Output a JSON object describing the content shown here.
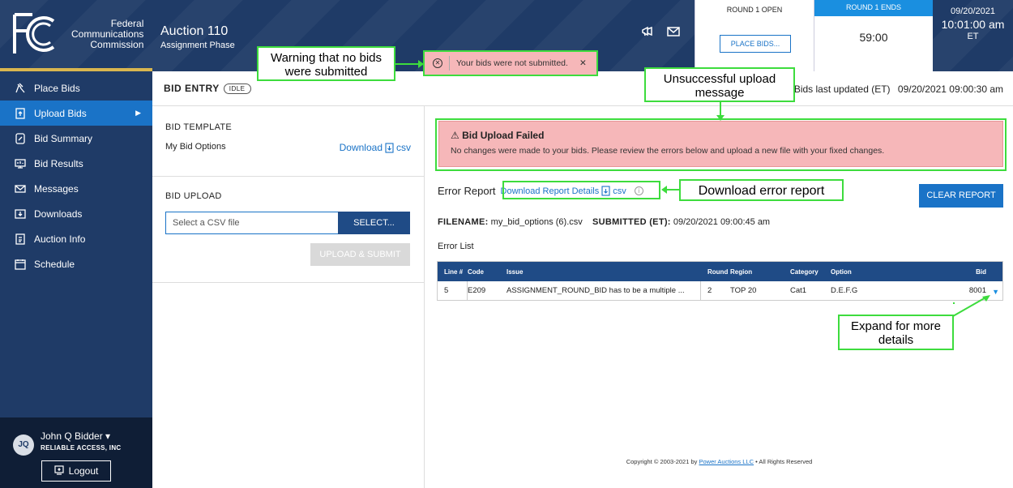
{
  "header": {
    "org_line1": "Federal",
    "org_line2": "Communications",
    "org_line3": "Commission",
    "auction_title": "Auction 110",
    "auction_phase": "Assignment Phase",
    "round_open_label": "ROUND 1 OPEN",
    "place_bids_button": "PLACE BIDS...",
    "round_ends_label": "ROUND 1 ENDS",
    "round_timer": "59:00",
    "date": "09/20/2021",
    "time": "10:01:00 am",
    "timezone": "ET"
  },
  "sidebar": {
    "items": [
      {
        "label": "Place Bids",
        "icon": "gavel-icon"
      },
      {
        "label": "Upload Bids",
        "icon": "upload-file-icon",
        "active": true
      },
      {
        "label": "Bid Summary",
        "icon": "summary-icon"
      },
      {
        "label": "Bid Results",
        "icon": "results-icon"
      },
      {
        "label": "Messages",
        "icon": "mail-icon"
      },
      {
        "label": "Downloads",
        "icon": "download-icon"
      },
      {
        "label": "Auction Info",
        "icon": "info-doc-icon"
      },
      {
        "label": "Schedule",
        "icon": "calendar-icon"
      }
    ],
    "user_initials": "JQ",
    "user_name": "John Q Bidder ▾",
    "user_org": "RELIABLE ACCESS, INC",
    "logout_label": "Logout"
  },
  "subheader": {
    "bid_entry": "BID ENTRY",
    "status": "IDLE",
    "last_updated_label": "Bids last updated (ET)",
    "last_updated_value": "09/20/2021 09:00:30 am"
  },
  "left_panel": {
    "template_title": "BID TEMPLATE",
    "template_option": "My Bid Options",
    "download_label": "Download",
    "download_ext": "csv",
    "upload_title": "BID UPLOAD",
    "csv_placeholder": "Select a CSV file",
    "select_button": "SELECT...",
    "upload_button": "UPLOAD & SUBMIT"
  },
  "right_panel": {
    "fail_title": "⚠ Bid Upload Failed",
    "fail_message": "No changes were made to your bids. Please review the errors below and upload a new file with your fixed changes.",
    "error_report_label": "Error Report",
    "download_report_label": "Download Report Details",
    "download_report_ext": "csv",
    "clear_report_button": "CLEAR REPORT",
    "filename_label": "FILENAME:",
    "filename_value": "my_bid_options (6).csv",
    "submitted_label": "SUBMITTED (ET):",
    "submitted_value": "09/20/2021 09:00:45 am",
    "error_list_label": "Error List",
    "table": {
      "headers": [
        "Line #",
        "Code",
        "Issue",
        "Round",
        "Region",
        "Category",
        "Option",
        "Bid"
      ],
      "rows": [
        [
          "5",
          "E209",
          "ASSIGNMENT_ROUND_BID has to be a multiple ...",
          "2",
          "TOP 20",
          "Cat1",
          "D.E.F.G",
          "8001"
        ]
      ]
    },
    "copyright_prefix": "Copyright © 2003-2021 by",
    "copyright_link": "Power Auctions LLC",
    "copyright_suffix": "• All Rights Reserved"
  },
  "banner": {
    "message": "Your bids were not submitted."
  },
  "annotations": {
    "warning_callout": "Warning that no bids were submitted",
    "upload_fail_callout": "Unsuccessful upload message",
    "download_error_callout": "Download error report",
    "expand_callout": "Expand for more details"
  },
  "colors": {
    "navy": "#1f3b67",
    "accent_blue": "#1a73c7",
    "error_pink": "#f6b7b9",
    "annotation_green": "#3ddc3d"
  }
}
